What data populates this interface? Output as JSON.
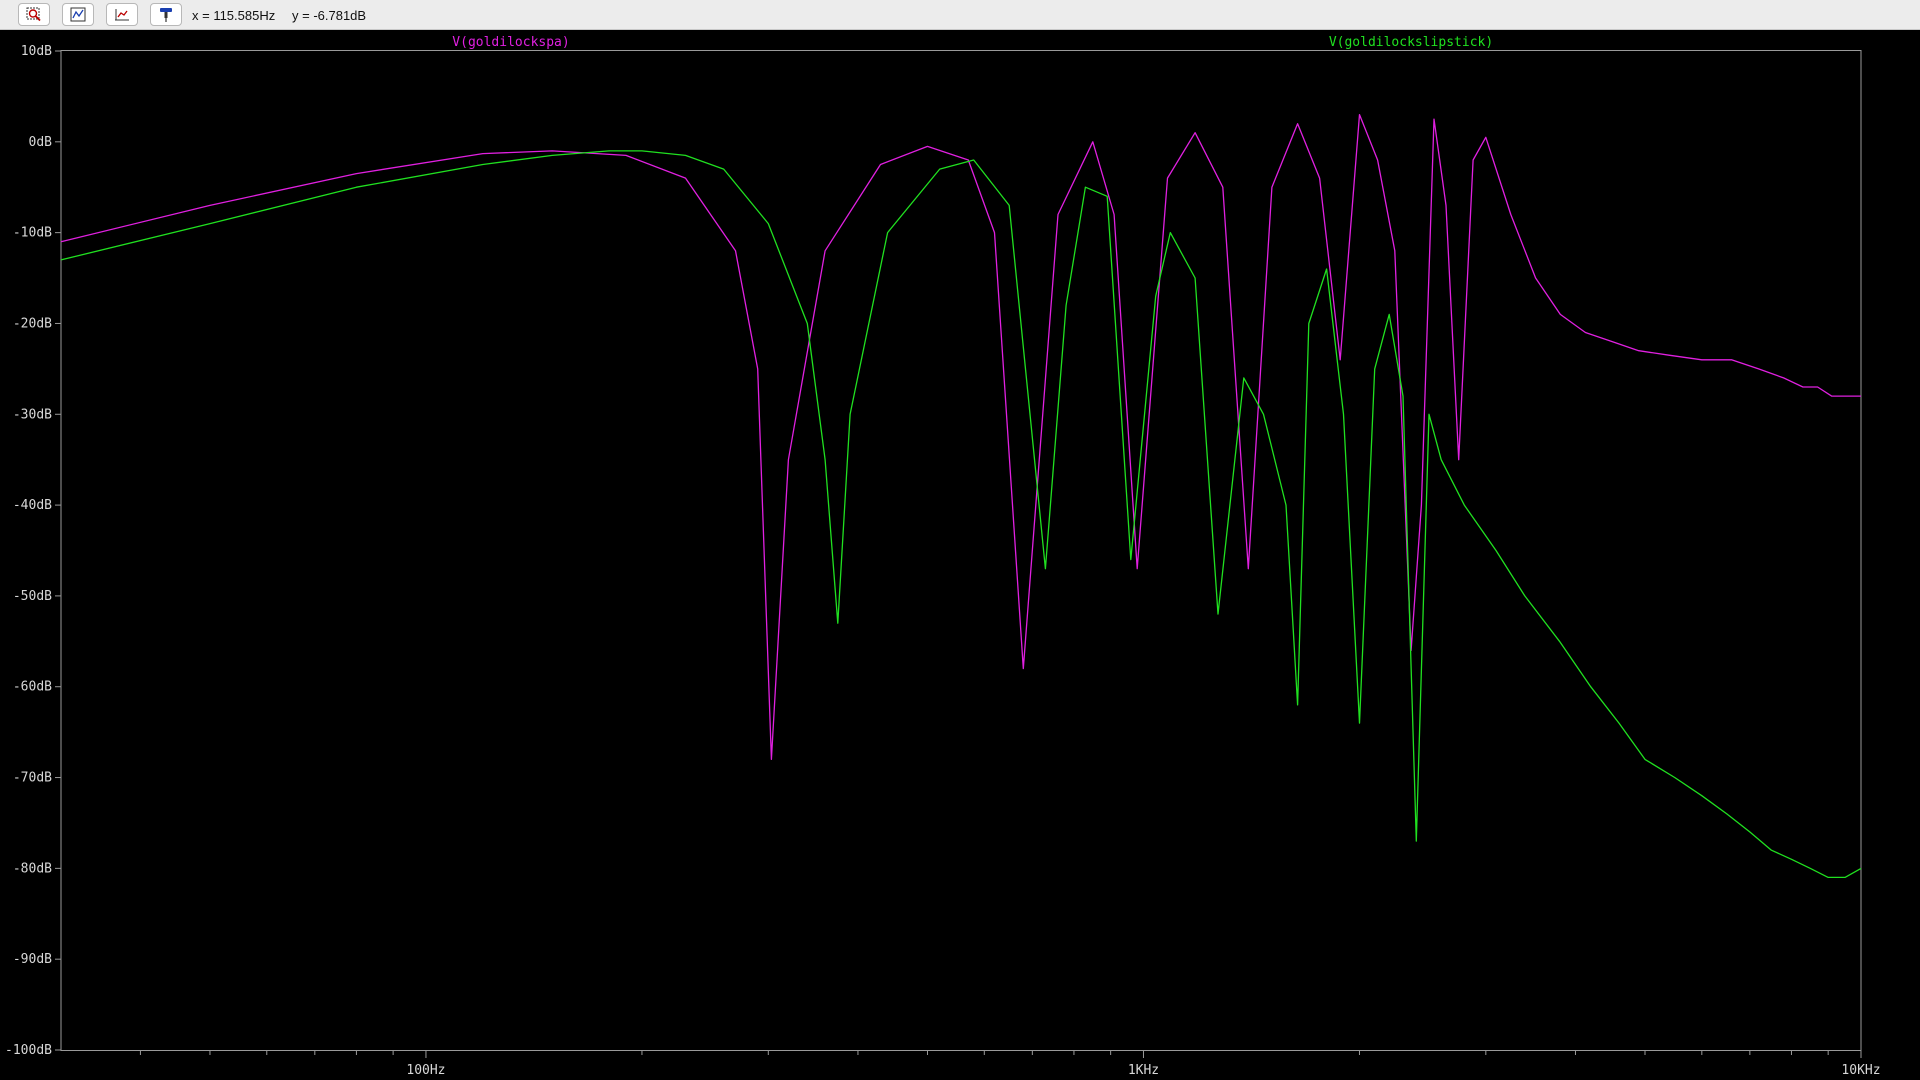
{
  "toolbar": {
    "buttons": [
      {
        "icon": "zoom-area-icon"
      },
      {
        "icon": "zoom-fit-icon"
      },
      {
        "icon": "zoom-out-icon"
      },
      {
        "icon": "probe-icon"
      }
    ],
    "cursor_x": "x = 115.585Hz",
    "cursor_y": "y = -6.781dB"
  },
  "chart_data": {
    "type": "line",
    "background": "#000000",
    "grid": false,
    "x_scale": "log",
    "xlim": [
      31,
      10000
    ],
    "ylim": [
      -100,
      10
    ],
    "x_ticks": [
      {
        "value": 100,
        "label": "100Hz"
      },
      {
        "value": 1000,
        "label": "1KHz"
      },
      {
        "value": 10000,
        "label": "10KHz"
      }
    ],
    "y_ticks": [
      {
        "value": 10,
        "label": "10dB"
      },
      {
        "value": 0,
        "label": "0dB"
      },
      {
        "value": -10,
        "label": "-10dB"
      },
      {
        "value": -20,
        "label": "-20dB"
      },
      {
        "value": -30,
        "label": "-30dB"
      },
      {
        "value": -40,
        "label": "-40dB"
      },
      {
        "value": -50,
        "label": "-50dB"
      },
      {
        "value": -60,
        "label": "-60dB"
      },
      {
        "value": -70,
        "label": "-70dB"
      },
      {
        "value": -80,
        "label": "-80dB"
      },
      {
        "value": -90,
        "label": "-90dB"
      },
      {
        "value": -100,
        "label": "-100dB"
      }
    ],
    "series": [
      {
        "name": "V(goldilockspa)",
        "color": "#e020e0",
        "legend_position": "top-left",
        "x": [
          31,
          50,
          80,
          120,
          150,
          190,
          230,
          270,
          290,
          303,
          320,
          360,
          430,
          500,
          570,
          620,
          680,
          760,
          850,
          910,
          980,
          1080,
          1180,
          1290,
          1400,
          1510,
          1640,
          1760,
          1880,
          2000,
          2120,
          2240,
          2360,
          2440,
          2540,
          2640,
          2750,
          2880,
          3000,
          3250,
          3520,
          3810,
          4130,
          4500,
          4900,
          5400,
          6000,
          6600,
          7200,
          7800,
          8300,
          8700,
          9100,
          9500,
          10000
        ],
        "y": [
          -11,
          -7,
          -3.5,
          -1.3,
          -1,
          -1.5,
          -4,
          -12,
          -25,
          -68,
          -35,
          -12,
          -2.5,
          -0.5,
          -2,
          -10,
          -58,
          -8,
          0,
          -8,
          -47,
          -4,
          1,
          -5,
          -47,
          -5,
          2,
          -4,
          -24,
          3,
          -2,
          -12,
          -56,
          -40,
          2.5,
          -7,
          -35,
          -2,
          0.5,
          -8,
          -15,
          -19,
          -21,
          -22,
          -23,
          -23.5,
          -24,
          -24,
          -25,
          -26,
          -27,
          -27,
          -28,
          -28,
          -28
        ]
      },
      {
        "name": "V(goldilockslipstick)",
        "color": "#20e020",
        "legend_position": "top-right",
        "x": [
          31,
          50,
          80,
          120,
          150,
          180,
          200,
          230,
          260,
          300,
          340,
          360,
          375,
          390,
          440,
          520,
          580,
          650,
          730,
          780,
          830,
          890,
          960,
          1040,
          1090,
          1180,
          1270,
          1380,
          1470,
          1580,
          1640,
          1700,
          1800,
          1900,
          2000,
          2100,
          2200,
          2300,
          2400,
          2500,
          2600,
          2800,
          3100,
          3400,
          3800,
          4200,
          4600,
          5000,
          5500,
          6000,
          6500,
          7000,
          7500,
          8000,
          8500,
          9000,
          9500,
          10000
        ],
        "y": [
          -13,
          -9,
          -5,
          -2.5,
          -1.5,
          -1,
          -1,
          -1.5,
          -3,
          -9,
          -20,
          -35,
          -53,
          -30,
          -10,
          -3,
          -2,
          -7,
          -47,
          -18,
          -5,
          -6,
          -46,
          -17,
          -10,
          -15,
          -52,
          -26,
          -30,
          -40,
          -62,
          -20,
          -14,
          -30,
          -64,
          -25,
          -19,
          -28,
          -77,
          -30,
          -35,
          -40,
          -45,
          -50,
          -55,
          -60,
          -64,
          -68,
          -70,
          -72,
          -74,
          -76,
          -78,
          -79,
          -80,
          -81,
          -81,
          -80
        ]
      }
    ]
  }
}
